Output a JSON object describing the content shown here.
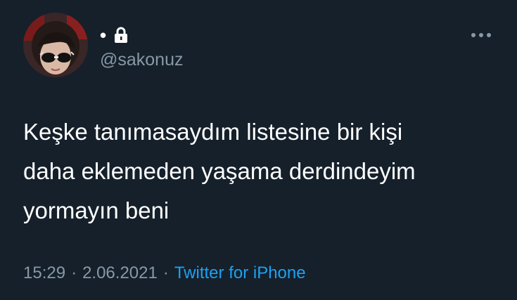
{
  "author": {
    "display_name": "•",
    "handle": "@sakonuz",
    "protected": true
  },
  "tweet": {
    "lines": [
      "Keşke tanımasaydım listesine bir kişi",
      "daha eklemeden yaşama derdindeyim",
      "yormayın beni"
    ]
  },
  "meta": {
    "time": "15:29",
    "separator": "·",
    "date": "2.06.2021",
    "source": "Twitter for iPhone"
  },
  "icons": {
    "lock": "lock-icon",
    "more": "more-horizontal-icon"
  },
  "colors": {
    "background": "#15202b",
    "text": "#ffffff",
    "secondary": "#8899a6",
    "link": "#1da1f2"
  }
}
